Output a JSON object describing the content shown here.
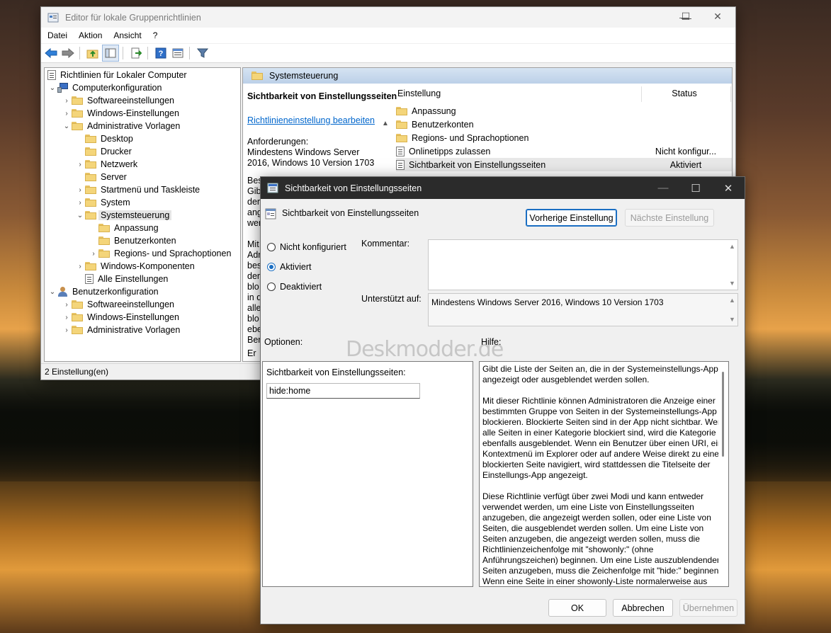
{
  "main_window": {
    "title": "Editor für lokale Gruppenrichtlinien",
    "controls": {
      "minimize": "—",
      "maximize": "☐",
      "close": "✕"
    },
    "menu": [
      "Datei",
      "Aktion",
      "Ansicht",
      "?"
    ],
    "toolbar_icons": [
      "back-arrow-icon",
      "forward-arrow-icon",
      "up-folder-icon",
      "show-hide-tree-icon",
      "export-list-icon",
      "help-icon",
      "properties-icon",
      "filter-icon"
    ],
    "tree": [
      {
        "label": "Richtlinien für Lokaler Computer",
        "icon": "doc-icon",
        "level": 0,
        "chevron": ""
      },
      {
        "label": "Computerkonfiguration",
        "icon": "computer-icon",
        "level": 1,
        "chevron": "⌄"
      },
      {
        "label": "Softwareeinstellungen",
        "icon": "folder-icon",
        "level": 2,
        "chevron": "›"
      },
      {
        "label": "Windows-Einstellungen",
        "icon": "folder-icon",
        "level": 2,
        "chevron": "›"
      },
      {
        "label": "Administrative Vorlagen",
        "icon": "folder-icon",
        "level": 2,
        "chevron": "⌄"
      },
      {
        "label": "Desktop",
        "icon": "folder-icon",
        "level": 3,
        "chevron": ""
      },
      {
        "label": "Drucker",
        "icon": "folder-icon",
        "level": 3,
        "chevron": ""
      },
      {
        "label": "Netzwerk",
        "icon": "folder-icon",
        "level": 3,
        "chevron": "›"
      },
      {
        "label": "Server",
        "icon": "folder-icon",
        "level": 3,
        "chevron": ""
      },
      {
        "label": "Startmenü und Taskleiste",
        "icon": "folder-icon",
        "level": 3,
        "chevron": "›"
      },
      {
        "label": "System",
        "icon": "folder-icon",
        "level": 3,
        "chevron": "›"
      },
      {
        "label": "Systemsteuerung",
        "icon": "folder-icon",
        "level": 3,
        "chevron": "⌄",
        "selected": true
      },
      {
        "label": "Anpassung",
        "icon": "folder-icon",
        "level": 4,
        "chevron": ""
      },
      {
        "label": "Benutzerkonten",
        "icon": "folder-icon",
        "level": 4,
        "chevron": ""
      },
      {
        "label": "Regions- und Sprachoptionen",
        "icon": "folder-icon",
        "level": 4,
        "chevron": "›"
      },
      {
        "label": "Windows-Komponenten",
        "icon": "folder-icon",
        "level": 3,
        "chevron": "›"
      },
      {
        "label": "Alle Einstellungen",
        "icon": "doc-icon",
        "level": 3,
        "chevron": ""
      },
      {
        "label": "Benutzerkonfiguration",
        "icon": "user-icon",
        "level": 1,
        "chevron": "⌄"
      },
      {
        "label": "Softwareeinstellungen",
        "icon": "folder-icon",
        "level": 2,
        "chevron": "›"
      },
      {
        "label": "Windows-Einstellungen",
        "icon": "folder-icon",
        "level": 2,
        "chevron": "›"
      },
      {
        "label": "Administrative Vorlagen",
        "icon": "folder-icon",
        "level": 2,
        "chevron": "›"
      }
    ],
    "status_bar": "2 Einstellung(en)",
    "right_pane": {
      "header": "Systemsteuerung",
      "extended_title": "Sichtbarkeit von Einstellungsseiten",
      "edit_link": "Richtlinieneinstellung bearbeiten",
      "requirements_label": "Anforderungen:",
      "requirements_value": "Mindestens Windows Server 2016, Windows 10 Version 1703",
      "desc_fragments": [
        "Bes",
        "Gib",
        "der",
        "ang",
        "wer",
        "",
        "Mit",
        "Adr",
        "bes",
        "der",
        "blo",
        "in d",
        "alle",
        "blo",
        "ebe",
        "Ber"
      ],
      "bottom_tab": "Er",
      "columns": {
        "setting": "Einstellung",
        "status": "Status"
      },
      "rows": [
        {
          "label": "Anpassung",
          "icon": "folder-icon",
          "status": ""
        },
        {
          "label": "Benutzerkonten",
          "icon": "folder-icon",
          "status": ""
        },
        {
          "label": "Regions- und Sprachoptionen",
          "icon": "folder-icon",
          "status": ""
        },
        {
          "label": "Onlinetipps zulassen",
          "icon": "setting-icon",
          "status": "Nicht konfigur..."
        },
        {
          "label": "Sichtbarkeit von Einstellungsseiten",
          "icon": "setting-icon",
          "status": "Aktiviert",
          "selected": true
        }
      ]
    }
  },
  "dialog": {
    "title": "Sichtbarkeit von Einstellungsseiten",
    "controls": {
      "minimize": "—",
      "maximize": "☐",
      "close": "✕"
    },
    "setting_name": "Sichtbarkeit von Einstellungsseiten",
    "prev_button": "Vorherige Einstellung",
    "next_button": "Nächste Einstellung",
    "radios": [
      {
        "label": "Nicht konfiguriert",
        "checked": false
      },
      {
        "label": "Aktiviert",
        "checked": true
      },
      {
        "label": "Deaktiviert",
        "checked": false
      }
    ],
    "comment_label": "Kommentar:",
    "comment_value": "",
    "supported_label": "Unterstützt auf:",
    "supported_value": "Mindestens Windows Server 2016, Windows 10 Version 1703",
    "options_label": "Optionen:",
    "help_label": "Hilfe:",
    "watermark": "Deskmodder.de",
    "option_field_label": "Sichtbarkeit von Einstellungsseiten:",
    "option_field_value": "hide:home",
    "help_paragraphs": [
      "Gibt die Liste der Seiten an, die in der Systemeinstellungs-App angezeigt oder ausgeblendet werden sollen.",
      "Mit dieser Richtlinie können Administratoren die Anzeige einer bestimmten Gruppe von Seiten in der Systemeinstellungs-App blockieren. Blockierte Seiten sind in der App nicht sichtbar. Wenn alle Seiten in einer Kategorie blockiert sind, wird die Kategorie ebenfalls ausgeblendet. Wenn ein Benutzer über einen URI, ein Kontextmenü im Explorer oder auf andere Weise direkt zu einer blockierten Seite navigiert, wird stattdessen die Titelseite der Einstellungs-App angezeigt.",
      "Diese Richtlinie verfügt über zwei Modi und kann entweder verwendet werden, um eine Liste von Einstellungsseiten anzugeben, die angezeigt werden sollen, oder eine Liste von Seiten, die ausgeblendet werden sollen. Um eine Liste von Seiten anzugeben, die angezeigt werden sollen, muss die Richtlinienzeichenfolge mit \"showonly:\" (ohne Anführungszeichen) beginnen. Um eine Liste auszublendender Seiten anzugeben, muss die Zeichenfolge mit \"hide:\" beginnen. Wenn eine Seite in einer showonly-Liste normalerweise aus"
    ],
    "ok_button": "OK",
    "cancel_button": "Abbrechen",
    "apply_button": "Übernehmen"
  }
}
